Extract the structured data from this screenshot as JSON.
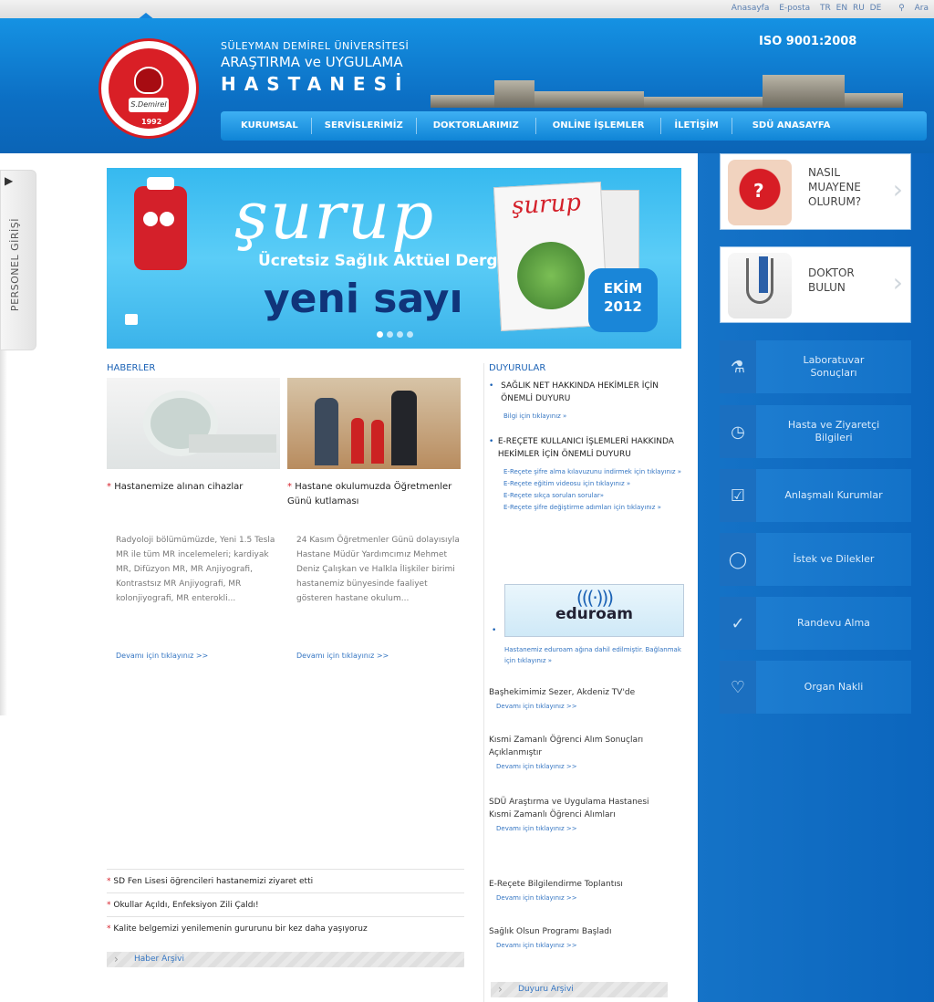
{
  "topbar": {
    "links": [
      "Anasayfa",
      "E-posta",
      "TR",
      "EN",
      "RU",
      "DE",
      "Ara"
    ]
  },
  "header": {
    "name_line1": "SÜLEYMAN DEMİREL ÜNİVERSİTESİ",
    "name_line2": "ARAŞTIRMA ve UYGULAMA",
    "name_line3": "HASTANESİ",
    "iso": "ISO 9001:2008",
    "logo_year": "1992",
    "logo_signature": "S.Demirel",
    "nav": [
      "KURUMSAL",
      "SERVİSLERİMİZ",
      "DOKTORLARIMIZ",
      "ONLİNE İŞLEMLER",
      "İLETİŞİM",
      "SDÜ ANASAYFA"
    ]
  },
  "left_tab": {
    "label": "PERSONEL GİRİŞİ"
  },
  "banner": {
    "brand": "şurup",
    "subtitle": "Ücretsiz Sağlık Aktüel Dergi",
    "issue": "yeni sayı",
    "badge_line1": "EKİM",
    "badge_line2": "2012",
    "magazine_title": "şurup"
  },
  "news": {
    "title": "HABERLER",
    "items": [
      {
        "title": "Hastanemize alınan cihazlar",
        "body": "Radyoloji bölümümüzde, Yeni 1.5 Tesla MR ile tüm MR incelemeleri; kardiyak MR, Difüzyon MR, MR Anjiyografi, Kontrastsız MR Anjiyografi, MR kolonjiyografi, MR enterokli...",
        "more": "Devamı için tıklayınız >>"
      },
      {
        "title": "Hastane okulumuzda Öğretmenler Günü kutlaması",
        "body": "24 Kasım Öğretmenler Günü dolayısıyla Hastane Müdür Yardımcımız Mehmet Deniz Çalışkan ve Halkla İlişkiler birimi hastanemiz bünyesinde faaliyet gösteren hastane okulum...",
        "more": "Devamı için tıklayınız >>"
      }
    ],
    "list": [
      "SD Fen Lisesi öğrencileri hastanemizi ziyaret etti",
      "Okullar Açıldı, Enfeksiyon Zili Çaldı!",
      "Kalite belgemizi yenilemenin gururunu bir kez daha yaşıyoruz"
    ],
    "archive": "Haber Arşivi"
  },
  "announcements": {
    "title": "DUYURULAR",
    "items": [
      {
        "title": "SAĞLIK NET HAKKINDA HEKİMLER İÇİN ÖNEMLİ DUYURU",
        "links": [
          "Bilgi için tıklayınız »"
        ]
      },
      {
        "title": "E-REÇETE KULLANICI İŞLEMLERİ HAKKINDA HEKİMLER İÇİN ÖNEMLİ DUYURU",
        "links": [
          "E-Reçete şifre alma kılavuzunu indirmek için tıklayınız »",
          "E-Reçete eğitim videosu için tıklayınız »",
          "E-Reçete sıkça sorulan sorular»",
          "E-Reçete şifre değiştirme adımları için tıklayınız »"
        ]
      }
    ],
    "eduroam_caption": "Hastanemiz eduroam ağına dahil edilmiştir. Bağlanmak için tıklayınız »",
    "eduroam_logo": "eduroam",
    "more_items": [
      {
        "title": "Başhekimimiz Sezer, Akdeniz TV'de",
        "more": "Devamı için tıklayınız >>"
      },
      {
        "title": "Kısmi Zamanlı Öğrenci Alım Sonuçları Açıklanmıştır",
        "more": "Devamı için tıklayınız >>"
      },
      {
        "title": "SDÜ Araştırma ve Uygulama Hastanesi Kısmi Zamanlı Öğrenci Alımları",
        "more": "Devamı için tıklayınız >>"
      },
      {
        "title": "E-Reçete Bilgilendirme Toplantısı",
        "more": "Devamı için tıklayınız >>"
      },
      {
        "title": "Sağlık Olsun Programı Başladı",
        "more": "Devamı için tıklayınız >>"
      }
    ],
    "archive": "Duyuru Arşivi"
  },
  "sidebar": {
    "promos": [
      {
        "label": "NASIL MUAYENE OLURUM?",
        "icon": "question-heart-icon"
      },
      {
        "label": "DOKTOR BULUN",
        "icon": "stethoscope-icon"
      }
    ],
    "links": [
      {
        "label": "Laboratuvar Sonuçları",
        "icon": "flask-icon"
      },
      {
        "label": "Hasta ve Ziyaretçi Bilgileri",
        "icon": "clock-icon"
      },
      {
        "label": "Anlaşmalı Kurumlar",
        "icon": "document-check-icon"
      },
      {
        "label": "İstek ve Dilekler",
        "icon": "speech-bubble-icon"
      },
      {
        "label": "Randevu Alma",
        "icon": "check-circle-icon"
      },
      {
        "label": "Organ Nakli",
        "icon": "heart-plus-icon"
      }
    ]
  }
}
